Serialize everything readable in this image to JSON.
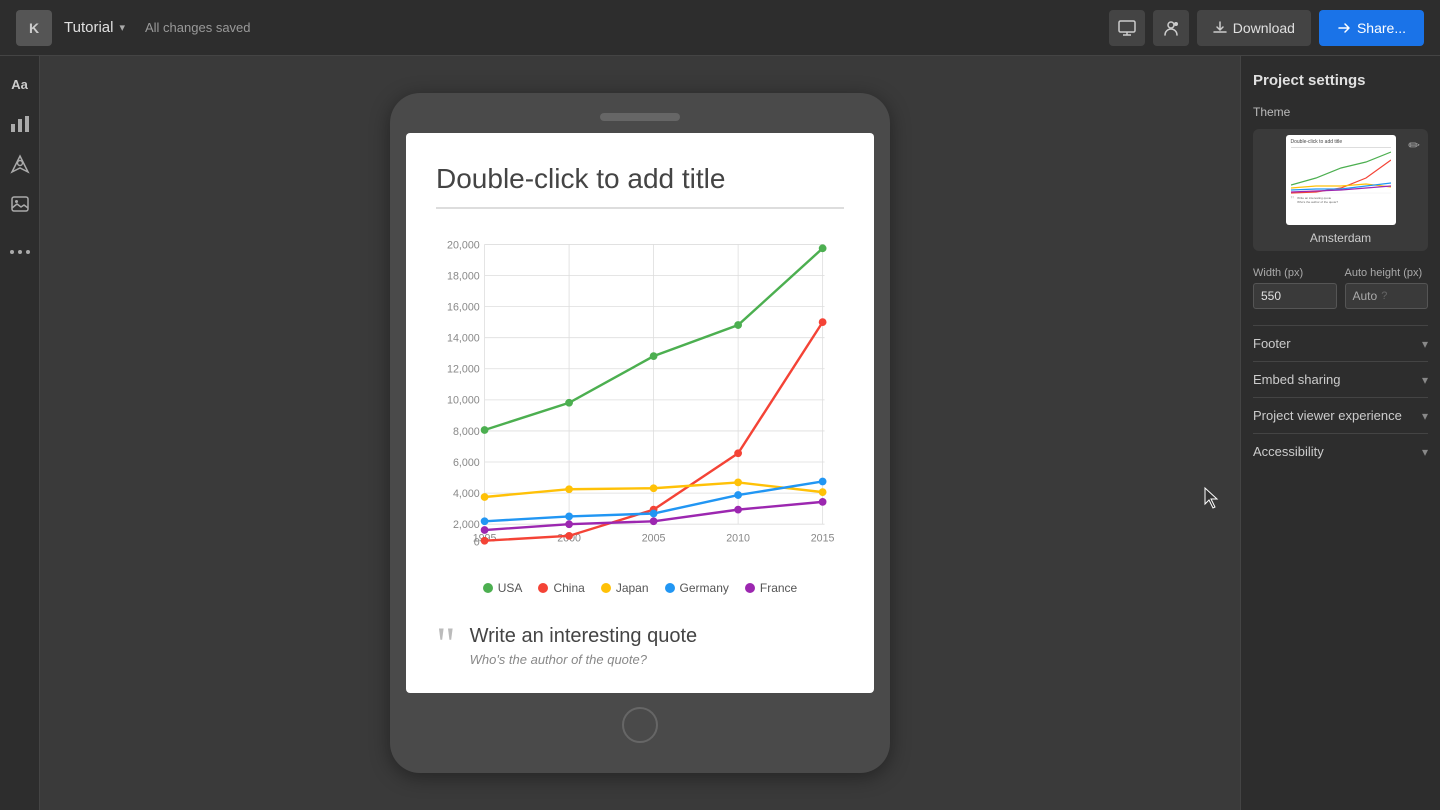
{
  "topbar": {
    "logo_text": "K",
    "title": "Tutorial",
    "status": "All changes saved",
    "download_label": "Download",
    "share_label": "Share..."
  },
  "left_sidebar": {
    "icons": [
      {
        "name": "text-icon",
        "symbol": "Aa",
        "active": false
      },
      {
        "name": "chart-icon",
        "symbol": "📊",
        "active": false
      },
      {
        "name": "map-icon",
        "symbol": "📍",
        "active": false
      },
      {
        "name": "image-icon",
        "symbol": "🖼",
        "active": false
      },
      {
        "name": "more-icon",
        "symbol": "•••",
        "active": false
      }
    ]
  },
  "slide": {
    "title": "Double-click to add title",
    "chart": {
      "y_labels": [
        "20,000",
        "18,000",
        "16,000",
        "14,000",
        "12,000",
        "10,000",
        "8,000",
        "6,000",
        "4,000",
        "2,000",
        "0"
      ],
      "x_labels": [
        "1995",
        "2000",
        "2005",
        "2010",
        "2015"
      ],
      "legend": [
        {
          "country": "USA",
          "color": "#4CAF50"
        },
        {
          "country": "China",
          "color": "#F44336"
        },
        {
          "country": "Japan",
          "color": "#FFC107"
        },
        {
          "country": "Germany",
          "color": "#2196F3"
        },
        {
          "country": "France",
          "color": "#9C27B0"
        }
      ]
    },
    "quote_text": "Write an interesting quote",
    "quote_author": "Who's the author of the quote?"
  },
  "right_sidebar": {
    "title": "Project settings",
    "theme_label": "Theme",
    "theme_name": "Amsterdam",
    "width_label": "Width (px)",
    "width_value": "550",
    "height_label": "Auto height (px)",
    "height_placeholder": "Auto",
    "accordion_items": [
      {
        "label": "Footer"
      },
      {
        "label": "Embed sharing"
      },
      {
        "label": "Project viewer experience"
      },
      {
        "label": "Accessibility"
      }
    ]
  }
}
